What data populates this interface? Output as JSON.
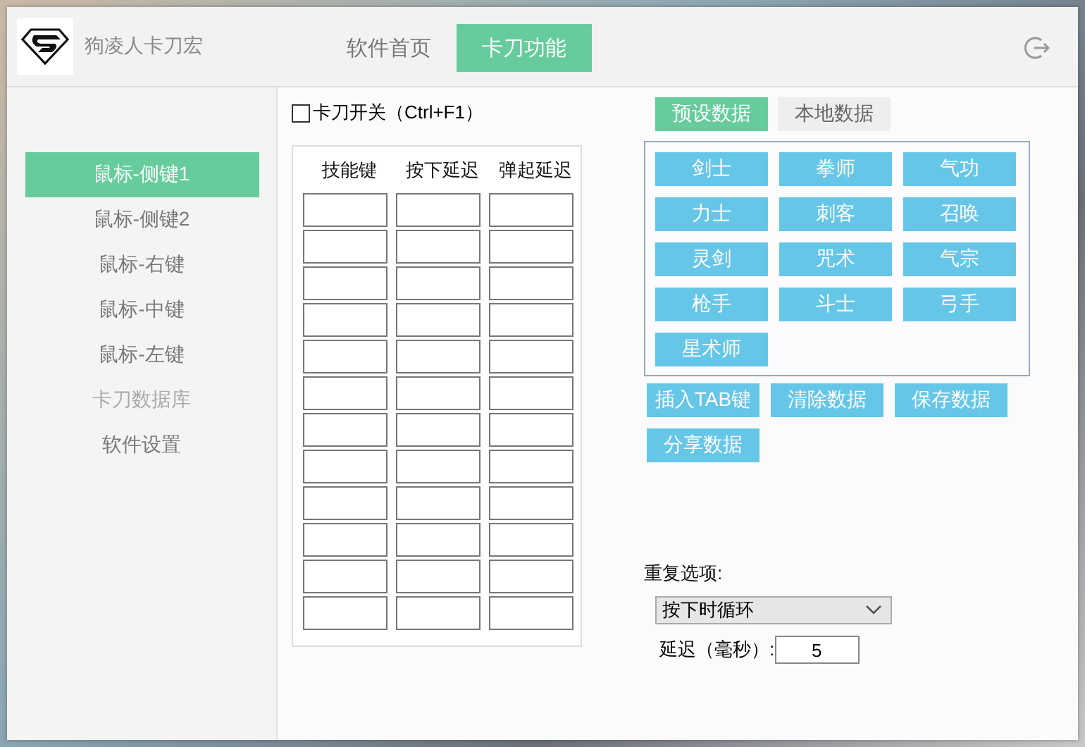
{
  "window": {
    "title": "狗凌人卡刀宏"
  },
  "tabs": [
    {
      "label": "软件首页",
      "selected": false
    },
    {
      "label": "卡刀功能",
      "selected": true
    }
  ],
  "sidebar": {
    "items": [
      {
        "label": "鼠标-侧键1",
        "selected": true,
        "disabled": false
      },
      {
        "label": "鼠标-侧键2",
        "selected": false,
        "disabled": false
      },
      {
        "label": "鼠标-右键",
        "selected": false,
        "disabled": false
      },
      {
        "label": "鼠标-中键",
        "selected": false,
        "disabled": false
      },
      {
        "label": "鼠标-左键",
        "selected": false,
        "disabled": false
      },
      {
        "label": "卡刀数据库",
        "selected": false,
        "disabled": true
      },
      {
        "label": "软件设置",
        "selected": false,
        "disabled": false
      }
    ]
  },
  "toggle": {
    "label": "卡刀开关（Ctrl+F1）",
    "checked": false
  },
  "table": {
    "columns": [
      "技能键",
      "按下延迟",
      "弹起延迟"
    ]
  },
  "data_tabs": [
    {
      "label": "预设数据",
      "selected": true
    },
    {
      "label": "本地数据",
      "selected": false
    }
  ],
  "classes": [
    "剑士",
    "拳师",
    "气功",
    "力士",
    "刺客",
    "召唤",
    "灵剑",
    "咒术",
    "气宗",
    "枪手",
    "斗士",
    "弓手",
    "星术师"
  ],
  "actions": [
    "插入TAB键",
    "清除数据",
    "保存数据",
    "分享数据"
  ],
  "repeat": {
    "label": "重复选项:",
    "value": "按下时循环"
  },
  "delay": {
    "label": "延迟（毫秒）:",
    "value": "5"
  }
}
